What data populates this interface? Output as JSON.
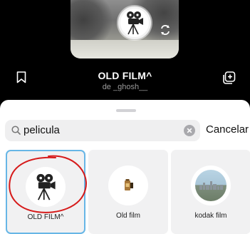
{
  "header": {
    "filter_name": "OLD FILM^",
    "author": "de _ghosh__"
  },
  "search": {
    "query": "pelicula",
    "cancel_label": "Cancelar"
  },
  "results": [
    {
      "label": "OLD FILM^",
      "selected": true,
      "icon": "film-camera-icon"
    },
    {
      "label": "Old film",
      "selected": false,
      "icon": "film-roll-icon"
    },
    {
      "label": "kodak film",
      "selected": false,
      "icon": "city-photo-thumbnail"
    }
  ],
  "colors": {
    "selection_border": "#67b6e6",
    "annotation": "#d61a1a"
  }
}
